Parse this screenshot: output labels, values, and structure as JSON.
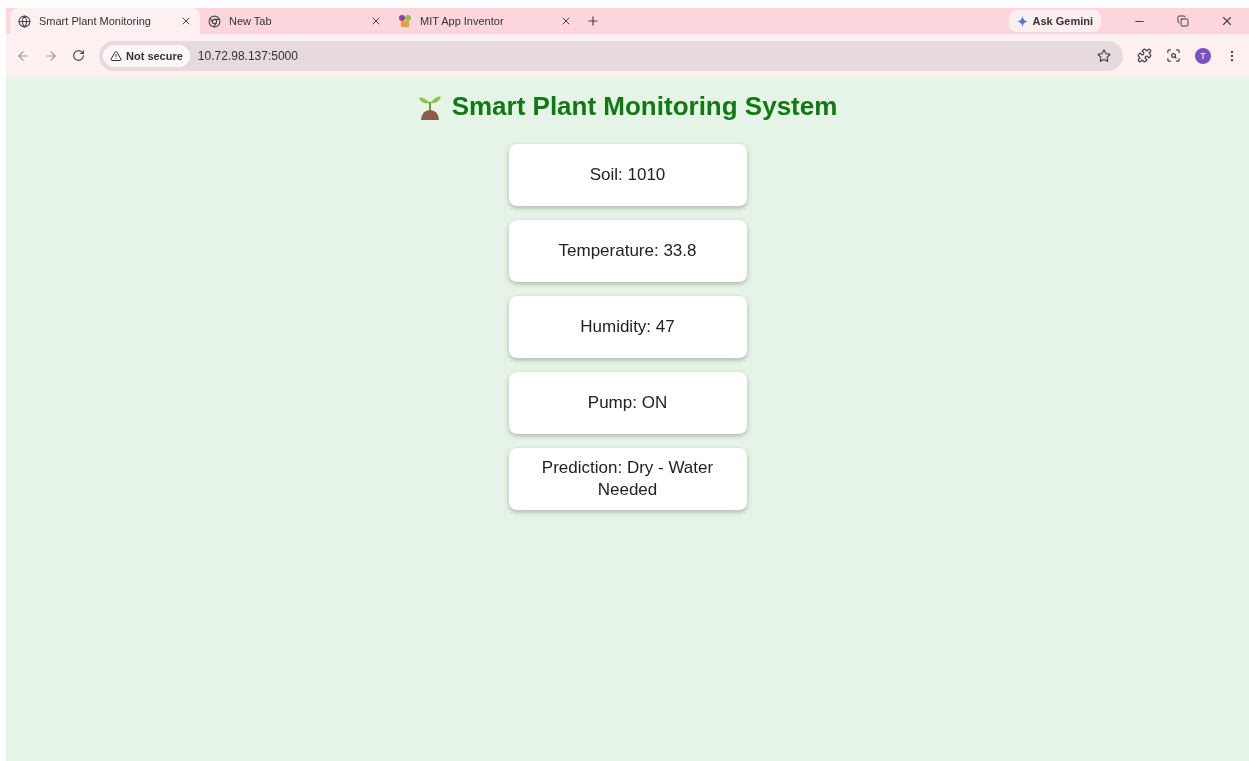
{
  "tabs": [
    {
      "label": "Smart Plant Monitoring",
      "selected": true
    },
    {
      "label": "New Tab",
      "selected": false
    },
    {
      "label": "MIT App Inventor",
      "selected": false
    }
  ],
  "ask_button": "Ask Gemini",
  "address_bar": {
    "security": "Not secure",
    "url": "10.72.98.137:5000"
  },
  "profile_initial": "T",
  "page": {
    "title": "Smart Plant Monitoring System",
    "cards": [
      {
        "text": "Soil: 1010"
      },
      {
        "text": "Temperature: 33.8"
      },
      {
        "text": "Humidity: 47"
      },
      {
        "text": "Pump: ON"
      },
      {
        "text": "Prediction: Dry - Water Needed"
      }
    ]
  }
}
